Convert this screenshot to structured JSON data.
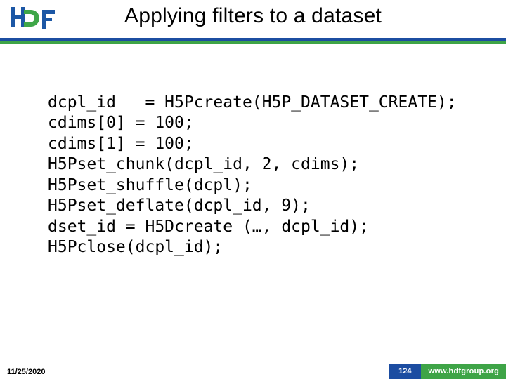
{
  "title": "Applying filters to a dataset",
  "code_lines": [
    "dcpl_id   = H5Pcreate(H5P_DATASET_CREATE);",
    "cdims[0] = 100;",
    "cdims[1] = 100;",
    "H5Pset_chunk(dcpl_id, 2, cdims);",
    "H5Pset_shuffle(dcpl);",
    "H5Pset_deflate(dcpl_id, 9);",
    "dset_id = H5Dcreate (…, dcpl_id);",
    "H5Pclose(dcpl_id);"
  ],
  "footer": {
    "date": "11/25/2020",
    "page": "124",
    "url": "www.hdfgroup.org"
  },
  "logo_text": {
    "h": "H",
    "d": "D",
    "f": "F"
  }
}
